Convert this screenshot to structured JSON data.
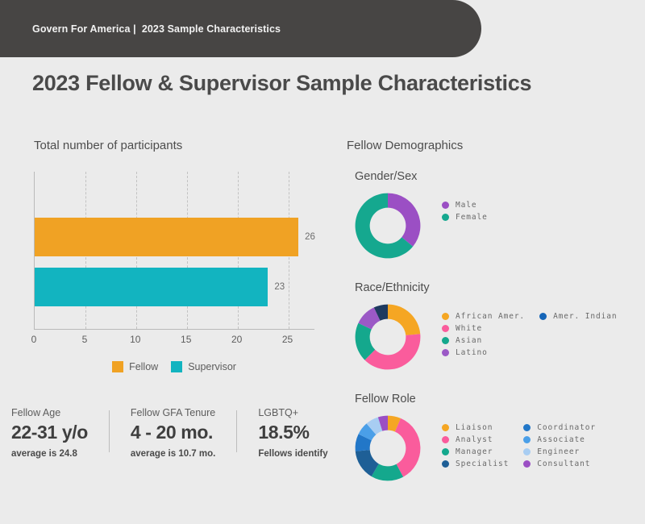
{
  "header": {
    "kicker": "Govern For America |  2023 Sample Characteristics",
    "title": "2023 Fellow & Supervisor Sample Characteristics",
    "bar_color": "#474544"
  },
  "bar_panel": {
    "title": "Total number of participants",
    "legend": [
      {
        "label": "Fellow",
        "color": "#F0A224"
      },
      {
        "label": "Supervisor",
        "color": "#12B4C0"
      }
    ]
  },
  "chart_data": [
    {
      "type": "bar",
      "title": "Total number of participants",
      "orientation": "horizontal",
      "categories": [
        "Fellow",
        "Supervisor"
      ],
      "values": [
        26,
        23
      ],
      "colors": [
        "#F0A224",
        "#12B4C0"
      ],
      "xlabel": "",
      "ylabel": "",
      "xlim": [
        0,
        27.5
      ],
      "ticks": [
        0,
        5,
        10,
        15,
        20,
        25
      ],
      "grid": "dashed-vertical",
      "legend": "bottom-center",
      "data_labels": [
        "26",
        "23"
      ]
    },
    {
      "type": "pie",
      "title": "Gender/Sex",
      "variant": "donut",
      "labels": [
        "Male",
        "Female"
      ],
      "values": [
        36,
        64
      ],
      "colors": [
        "#9B4FC4",
        "#15A88F"
      ],
      "legend": "right"
    },
    {
      "type": "pie",
      "title": "Race/Ethnicity",
      "variant": "donut",
      "labels": [
        "African Amer.",
        "White",
        "Asian",
        "Latino",
        "Amer. Indian"
      ],
      "values": [
        23.5,
        39,
        19.5,
        11,
        7
      ],
      "colors": [
        "#F5A623",
        "#FA5C9C",
        "#14A88D",
        "#9B59C6",
        "#1E3A5F"
      ],
      "legend_dot_colors": [
        "#F5A623",
        "#FA5C9C",
        "#14A88D",
        "#9B59C6",
        "#1565B8"
      ],
      "legend": "right-two-columns"
    },
    {
      "type": "pie",
      "title": "Fellow Role",
      "variant": "donut",
      "labels": [
        "Liaison",
        "Analyst",
        "Manager",
        "Specialist",
        "Coordinator",
        "Associate",
        "Engineer",
        "Consultant"
      ],
      "values": [
        6,
        33,
        15,
        14,
        8,
        6,
        6,
        4.5
      ],
      "colors": [
        "#F5A623",
        "#FA5C9C",
        "#14A88D",
        "#1E5F96",
        "#2277C8",
        "#4A9FE8",
        "#A8CDF2",
        "#9B4FC4"
      ],
      "legend": "right-two-columns"
    }
  ],
  "demographics": {
    "title": "Fellow Demographics",
    "gender": {
      "title": "Gender/Sex",
      "legend_columns": [
        [
          {
            "label": "Male",
            "color": "#9B4FC4"
          },
          {
            "label": "Female",
            "color": "#15A88F"
          }
        ]
      ]
    },
    "race": {
      "title": "Race/Ethnicity",
      "legend_columns": [
        [
          {
            "label": "African Amer.",
            "color": "#F5A623"
          },
          {
            "label": "White",
            "color": "#FA5C9C"
          },
          {
            "label": "Asian",
            "color": "#14A88D"
          },
          {
            "label": "Latino",
            "color": "#9B59C6"
          }
        ],
        [
          {
            "label": "Amer. Indian",
            "color": "#1565B8"
          }
        ]
      ]
    },
    "role": {
      "title": "Fellow Role",
      "legend_columns": [
        [
          {
            "label": "Liaison",
            "color": "#F5A623"
          },
          {
            "label": "Analyst",
            "color": "#FA5C9C"
          },
          {
            "label": "Manager",
            "color": "#14A88D"
          },
          {
            "label": "Specialist",
            "color": "#1E5F96"
          }
        ],
        [
          {
            "label": "Coordinator",
            "color": "#2277C8"
          },
          {
            "label": "Associate",
            "color": "#4A9FE8"
          },
          {
            "label": "Engineer",
            "color": "#A8CDF2"
          },
          {
            "label": "Consultant",
            "color": "#9B4FC4"
          }
        ]
      ]
    }
  },
  "stats": [
    {
      "label": "Fellow Age",
      "value": "22-31 y/o",
      "note": "average is 24.8"
    },
    {
      "label": "Fellow GFA Tenure",
      "value": "4 - 20 mo.",
      "note": "average is 10.7 mo."
    },
    {
      "label": "LGBTQ+",
      "value": "18.5%",
      "note": "Fellows identify"
    }
  ]
}
